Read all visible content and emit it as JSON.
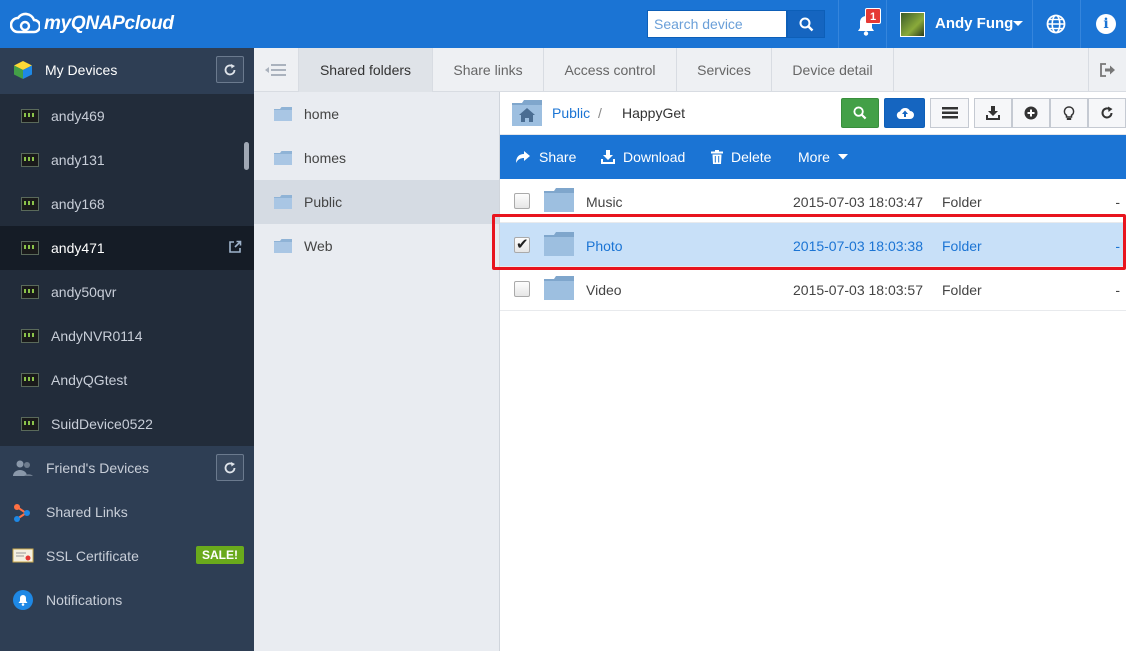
{
  "header": {
    "logo_text": "myQNAPcloud",
    "search_placeholder": "Search device",
    "notification_count": "1",
    "user_name": "Andy Fung"
  },
  "sidebar": {
    "my_devices_label": "My Devices",
    "devices": [
      {
        "name": "andy469"
      },
      {
        "name": "andy131"
      },
      {
        "name": "andy168"
      },
      {
        "name": "andy471",
        "active": true
      },
      {
        "name": "andy50qvr"
      },
      {
        "name": "AndyNVR0114"
      },
      {
        "name": "AndyQGtest"
      },
      {
        "name": "SuidDevice0522"
      }
    ],
    "friends_devices_label": "Friend's Devices",
    "shared_links_label": "Shared Links",
    "ssl_label": "SSL Certificate",
    "sale_badge": "SALE!",
    "notifications_label": "Notifications"
  },
  "tabs": [
    {
      "label": "Shared folders",
      "active": true
    },
    {
      "label": "Share links"
    },
    {
      "label": "Access control"
    },
    {
      "label": "Services"
    },
    {
      "label": "Device detail"
    }
  ],
  "folders": [
    {
      "name": "home"
    },
    {
      "name": "homes"
    },
    {
      "name": "Public",
      "active": true
    },
    {
      "name": "Web"
    }
  ],
  "breadcrumb": {
    "root": "Public",
    "separator": "/",
    "current": "HappyGet"
  },
  "actions": {
    "share": "Share",
    "download": "Download",
    "delete": "Delete",
    "more": "More"
  },
  "files": [
    {
      "name": "Music",
      "date": "2015-07-03 18:03:47",
      "type": "Folder",
      "size": "-",
      "checked": false
    },
    {
      "name": "Photo",
      "date": "2015-07-03 18:03:38",
      "type": "Folder",
      "size": "-",
      "checked": true
    },
    {
      "name": "Video",
      "date": "2015-07-03 18:03:57",
      "type": "Folder",
      "size": "-",
      "checked": false
    }
  ],
  "colors": {
    "brand_blue": "#1b74d4",
    "sidebar_bg": "#2e3e54",
    "selected_row": "#c8e0f8",
    "highlight_red": "#e8141e",
    "sale_green": "#6aaa1c"
  }
}
